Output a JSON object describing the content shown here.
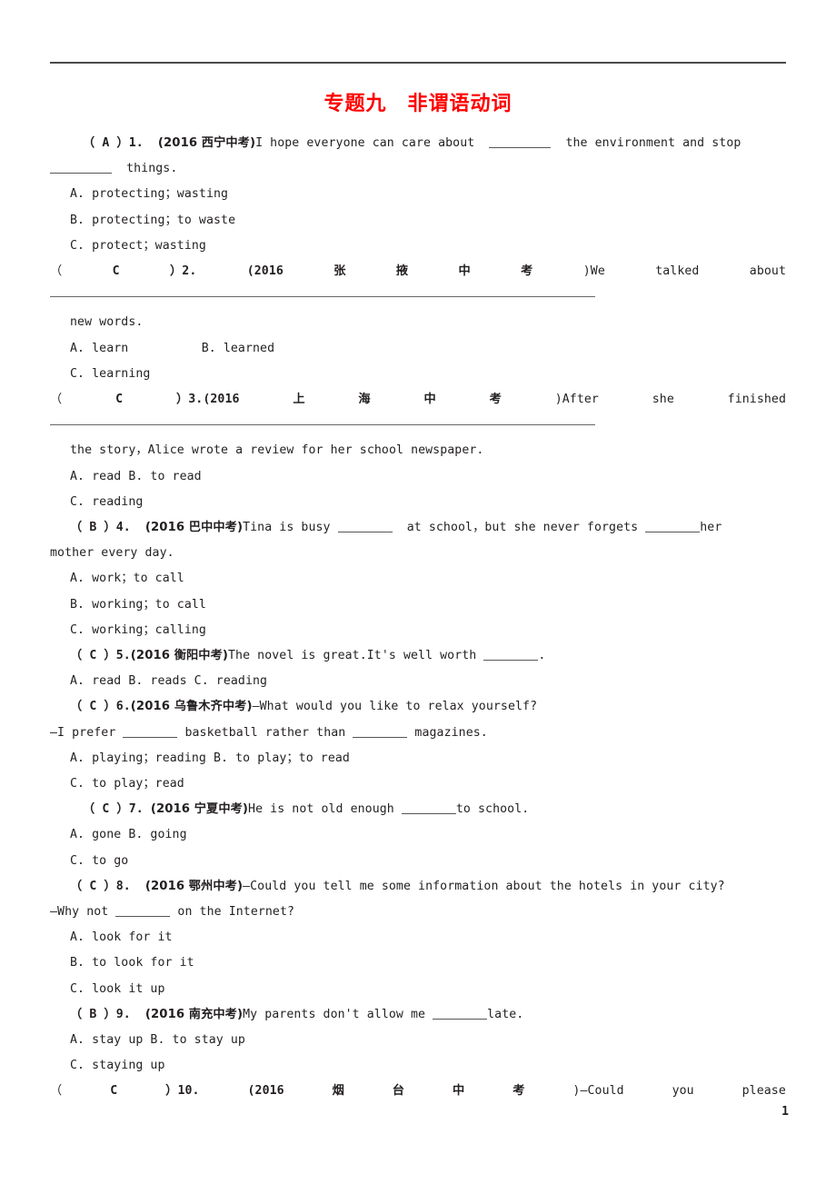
{
  "document": {
    "title": "专题九　非谓语动词",
    "title_color": "#ff0000",
    "page_number": "1"
  },
  "questions": [
    {
      "answer": "A",
      "number": "1.",
      "source": "(2016 西宁中考)",
      "stem_line1": "I  hope  everyone  can  care  about",
      "stem_line1_tail": "the  environment  and  stop",
      "stem_line2": "things.",
      "options": [
        "A. protecting；wasting",
        "B. protecting；to waste",
        "C. protect；wasting"
      ]
    },
    {
      "answer": "C",
      "number": "2.",
      "source_open": "(2016",
      "source_cn": "张 掖 中 考",
      "source_close": ")We",
      "stem_spread": [
        "talked",
        "about"
      ],
      "stem_line2": "new words.",
      "options": [
        "A. learn",
        "B. learned",
        "C. learning"
      ]
    },
    {
      "answer": "C",
      "number": "3.",
      "source_open": "(2016",
      "source_cn": "上 海 中 考",
      "source_close": ")After",
      "stem_spread": [
        "she",
        "finished"
      ],
      "stem_line2": "the story，Alice wrote a review for her school newspaper.",
      "options": [
        "A. read  B. to read",
        "C. reading"
      ]
    },
    {
      "answer": "B",
      "number": "4.",
      "source": "(2016 巴中中考)",
      "stem_line1_a": "Tina  is  busy",
      "stem_line1_b": "at  school，but  she  never  forgets",
      "stem_line1_c": "her",
      "stem_line2": "mother every day.",
      "options": [
        "A. work；to call",
        "B. working；to call",
        "C. working；calling"
      ]
    },
    {
      "answer": "C",
      "number": "5.",
      "source": "(2016 衡阳中考)",
      "stem": "The novel is great.It's well worth",
      "stem_tail": ".",
      "options": [
        "A. read    B. reads    C. reading"
      ]
    },
    {
      "answer": "C",
      "number": "6.",
      "source": "(2016 乌鲁木齐中考)",
      "stem": "—What would you like to relax yourself?",
      "stem_line2_a": "—I prefer",
      "stem_line2_b": "basketball rather than",
      "stem_line2_c": "magazines.",
      "options": [
        "A. playing；reading  B. to play；to read",
        "C. to play；read"
      ]
    },
    {
      "answer": "C",
      "number": "7.",
      "source": "(2016 宁夏中考)",
      "stem_a": "He is not old enough",
      "stem_b": "to school.",
      "options": [
        "A. gone  B. going",
        "C. to go"
      ]
    },
    {
      "answer": "C",
      "number": "8.",
      "source": "(2016 鄂州中考)",
      "stem": "—Could you tell me some information about the hotels in your city?",
      "stem_line2_a": "—Why not",
      "stem_line2_b": "on the Internet?",
      "options": [
        "A. look for it",
        "B. to look for it",
        "C. look it up"
      ]
    },
    {
      "answer": "B",
      "number": "9.",
      "source": "(2016 南充中考)",
      "stem_a": "My parents don't allow me",
      "stem_b": "late.",
      "options": [
        "A. stay up  B. to stay up",
        "C. staying up"
      ]
    },
    {
      "answer": "C",
      "number": "10.",
      "source_open": "(2016",
      "source_cn": "烟 台 中 考",
      "source_close": ")—Could",
      "stem_spread": [
        "you",
        "please"
      ]
    }
  ]
}
